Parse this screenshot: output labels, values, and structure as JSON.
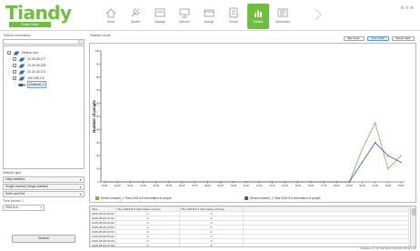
{
  "app": {
    "logo_text": "Tiandy",
    "logo_sub": "Smart Video",
    "window_controls": "⊕⊖⊗"
  },
  "nav": {
    "items": [
      {
        "label": "Home",
        "icon": "home-icon",
        "active": false
      },
      {
        "label": "System",
        "icon": "system-icon",
        "active": false
      },
      {
        "label": "Manage",
        "icon": "manage-icon",
        "active": false
      },
      {
        "label": "Network",
        "icon": "network-icon",
        "active": false
      },
      {
        "label": "Backup",
        "icon": "backup-icon",
        "active": false
      },
      {
        "label": "Device",
        "icon": "device-icon",
        "active": false
      },
      {
        "label": "Statistic",
        "icon": "statistic-icon",
        "active": true
      },
      {
        "label": "Information",
        "icon": "information-icon",
        "active": false
      }
    ]
  },
  "left": {
    "title": "Device information",
    "tree": [
      {
        "label": "Device root",
        "level": 0
      },
      {
        "label": "10.30.30.177",
        "level": 1
      },
      {
        "label": "10.30.30.228",
        "level": 1
      },
      {
        "label": "10.30.30.172",
        "level": 1
      },
      {
        "label": "192.168.1.5",
        "level": 1
      },
      {
        "label": "Channel_1",
        "level": 2,
        "selected": true
      }
    ],
    "stat_type_label": "Statistic type",
    "dropdowns": [
      {
        "value": "Daily statistics"
      },
      {
        "value": "Single channel (Single statistic)"
      },
      {
        "value": "Enter and Exit"
      }
    ],
    "time_label": "Time period: 1",
    "date_value": "2015-5-6",
    "search_label": "Search"
  },
  "right": {
    "title": "Statistic result",
    "buttons": [
      {
        "label": "Bar mode"
      },
      {
        "label": "Line mode",
        "active": true
      },
      {
        "label": "Export data"
      }
    ]
  },
  "chart_data": {
    "type": "line",
    "ylabel": "Number of people",
    "ylim": [
      0,
      100
    ],
    "yticks": [
      0,
      10,
      20,
      30,
      40,
      50,
      60,
      70,
      80,
      90,
      100
    ],
    "categories": [
      "00:00",
      "01:00",
      "02:00",
      "03:00",
      "04:00",
      "05:00",
      "06:00",
      "07:00",
      "08:00",
      "09:00",
      "10:00",
      "11:00",
      "12:00",
      "13:00",
      "14:00",
      "15:00",
      "16:00",
      "17:00",
      "18:00",
      "19:00",
      "20:00",
      "21:00",
      "22:00",
      "23:00"
    ],
    "series": [
      {
        "name": "Device channel_1 Time:2015-5-6 Information of people",
        "color": "#7db544",
        "values": [
          0,
          0,
          0,
          0,
          0,
          0,
          0,
          0,
          0,
          0,
          0,
          0,
          0,
          0,
          0,
          0,
          0,
          0,
          0,
          0,
          25,
          45,
          10,
          20
        ]
      },
      {
        "name": "Device channel_1 Time:2015-5-6 Information of people",
        "color": "#3b5ea8",
        "values": [
          0,
          0,
          0,
          0,
          0,
          0,
          0,
          0,
          0,
          0,
          0,
          0,
          0,
          0,
          0,
          0,
          0,
          0,
          0,
          0,
          15,
          30,
          20,
          15
        ]
      }
    ],
    "legend_position": "bottom",
    "grid": false
  },
  "table": {
    "headers": [
      "Time",
      "Time:2015-5-6 Information of entry",
      "Time:2015-5-6 Information of leave"
    ],
    "rows": [
      [
        "2015-05-06 00:00",
        "0",
        "0"
      ],
      [
        "2015-05-06 01:00",
        "0",
        "0"
      ],
      [
        "2015-05-06 02:00",
        "0",
        "0"
      ],
      [
        "2015-05-06 03:00",
        "0",
        "0"
      ],
      [
        "2015-05-06 04:00",
        "0",
        "0"
      ],
      [
        "2015-05-06 05:00",
        "0",
        "0"
      ],
      [
        "2015-05-06 06:00",
        "0",
        "0"
      ],
      [
        "2015-05-06 07:00",
        "0",
        "0"
      ],
      [
        "2015-05-06 08:00",
        "0",
        "0"
      ],
      [
        "2015-05-06 09:00",
        "0",
        "0"
      ]
    ]
  },
  "status_text": "Software:V7.32.3AB Build:4/1/2015 18:29 1:00"
}
